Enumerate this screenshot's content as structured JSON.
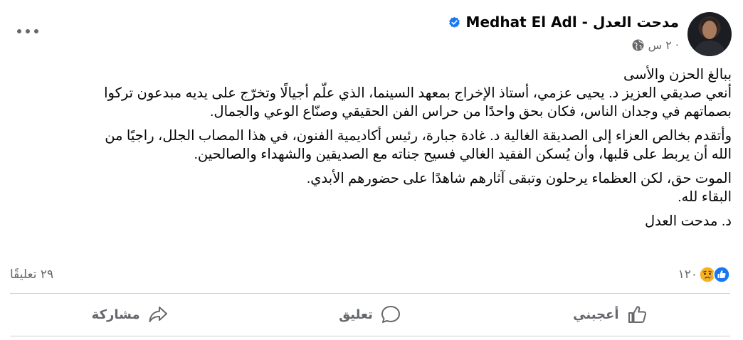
{
  "header": {
    "author_name": "Medhat El Adl - مدحت العدل",
    "timestamp": "٢ س ·",
    "verified_icon": "verified-badge-icon",
    "privacy_icon": "globe-icon",
    "more_icon": "more-options-icon"
  },
  "post": {
    "paragraphs": [
      {
        "lines": [
          "ببالغ الحزن والأسى",
          "أنعي صديقي العزيز د. يحيى عزمي، أستاذ الإخراج بمعهد السينما، الذي علّم أجيالًا وتخرّج على يديه مبدعون تركوا",
          "بصماتهم في وجدان الناس، فكان بحق واحدًا من حراس الفن الحقيقي وصنّاع الوعي والجمال."
        ]
      },
      {
        "lines": [
          "وأتقدم بخالص العزاء إلى الصديقة الغالية د. غادة جبارة، رئيس أكاديمية الفنون، في هذا المصاب الجلل، راجيًا من",
          "الله أن يربط على قلبها، وأن يُسكن الفقيد الغالي فسيح جناته مع الصديقين والشهداء والصالحين."
        ]
      },
      {
        "lines": [
          "الموت حق، لكن العظماء يرحلون وتبقى آثارهم شاهدًا على حضورهم الأبدي.",
          "البقاء لله."
        ]
      },
      {
        "lines": [
          "د. مدحت العدل"
        ]
      }
    ]
  },
  "stats": {
    "reactions_count": "١٢٠",
    "comments_count": "٢٩ تعليقًا",
    "reaction_icons": [
      "like-icon",
      "care-sad-icon"
    ]
  },
  "actions": {
    "like_label": "أعجبني",
    "comment_label": "تعليق",
    "share_label": "مشاركة"
  },
  "colors": {
    "text": "#050505",
    "secondary_text": "#65676b",
    "facebook_blue": "#1877f2",
    "divider": "#ced0d4",
    "sad_yellow": "#f7b125"
  }
}
